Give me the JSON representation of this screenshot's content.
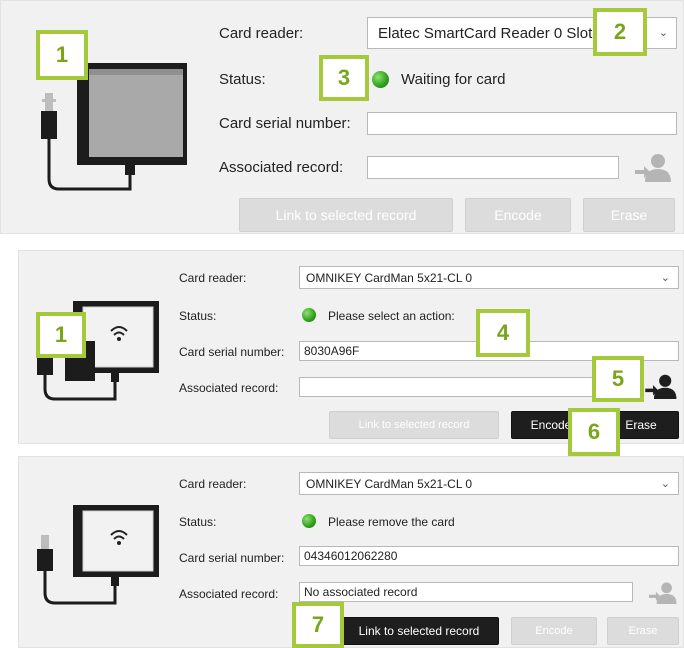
{
  "panel1": {
    "card_reader_label": "Card reader:",
    "card_reader_value": "Elatec SmartCard Reader 0 Slot",
    "status_label": "Status:",
    "status_value": "Waiting for card",
    "serial_label": "Card serial number:",
    "serial_value": "",
    "associated_label": "Associated record:",
    "associated_value": "",
    "btn_link": "Link to selected record",
    "btn_encode": "Encode",
    "btn_erase": "Erase"
  },
  "panel2": {
    "card_reader_label": "Card reader:",
    "card_reader_value": "OMNIKEY CardMan 5x21-CL 0",
    "status_label": "Status:",
    "status_value": "Please select an action:",
    "serial_label": "Card serial number:",
    "serial_value": "8030A96F",
    "associated_label": "Associated record:",
    "associated_value": "",
    "btn_link": "Link to selected record",
    "btn_encode": "Encode",
    "btn_erase": "Erase"
  },
  "panel3": {
    "card_reader_label": "Card reader:",
    "card_reader_value": "OMNIKEY CardMan 5x21-CL 0",
    "status_label": "Status:",
    "status_value": "Please remove the card",
    "serial_label": "Card serial number:",
    "serial_value": "04346012062280",
    "associated_label": "Associated record:",
    "associated_value": "No associated record",
    "btn_link": "Link to selected record",
    "btn_encode": "Encode",
    "btn_erase": "Erase"
  },
  "callouts": [
    "1",
    "2",
    "3",
    "1",
    "4",
    "5",
    "6",
    "7"
  ],
  "icons": {
    "dropdown": "chevron-down-icon",
    "status": "status-led-icon",
    "link_record": "link-person-icon",
    "reader": "card-reader-icon",
    "reader_rfid": "contactless-card-reader-icon"
  },
  "colors": {
    "callout": "#a4c93a",
    "status_led": "#2f9e1c",
    "button_active": "#1e1e1e",
    "button_disabled": "#dcdcdc"
  }
}
